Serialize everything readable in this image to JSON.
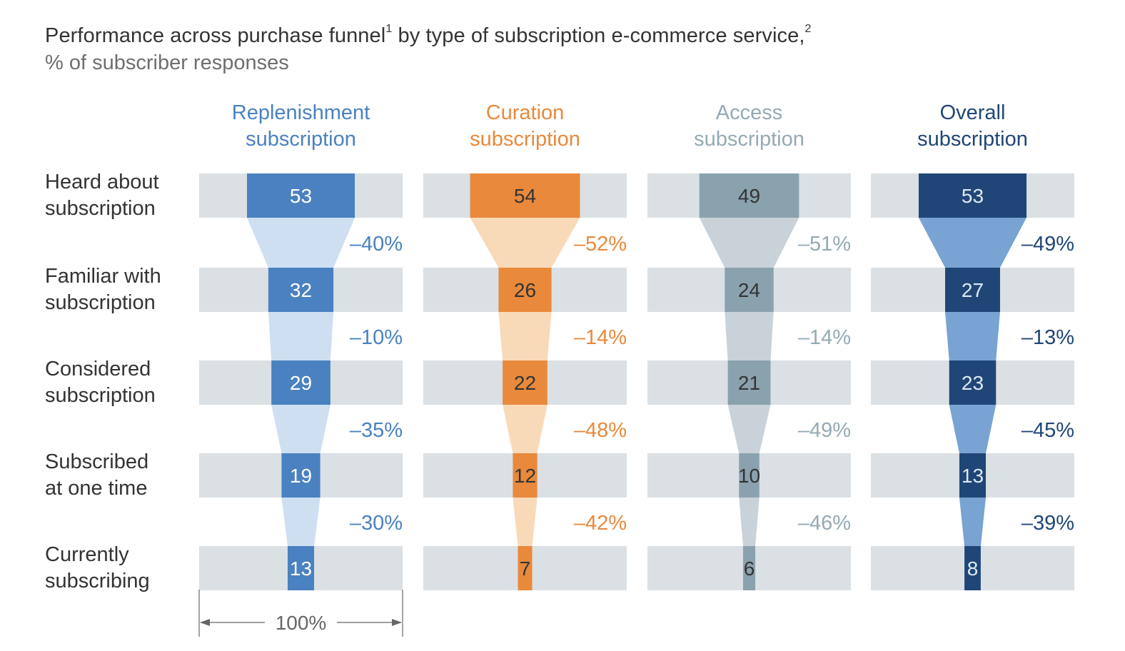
{
  "chart_data": {
    "type": "funnel",
    "title": "Performance across purchase funnel",
    "title_footnote_1": "1",
    "title_mid": " by type of subscription e-commerce service,",
    "title_footnote_2": "2",
    "subtitle": "% of subscriber responses",
    "stages": [
      [
        "Heard about",
        "subscription"
      ],
      [
        "Familiar with",
        "subscription"
      ],
      [
        "Considered",
        "subscription"
      ],
      [
        "Subscribed",
        "at one time"
      ],
      [
        "Currently",
        "subscribing"
      ]
    ],
    "scale_label": "100%",
    "xlim": [
      0,
      100
    ],
    "series": [
      {
        "name": [
          "Replenishment",
          "subscription"
        ],
        "color": "#4a81c0",
        "light": "#cddff1",
        "header_color": "#4a81c0",
        "drop_color": "#4a81c0",
        "value_text_color": "#ffffff",
        "values": [
          53,
          32,
          29,
          19,
          13
        ],
        "drops": [
          "–40%",
          "–10%",
          "–35%",
          "–30%"
        ]
      },
      {
        "name": [
          "Curation",
          "subscription"
        ],
        "color": "#e8893c",
        "light": "#f8dab9",
        "header_color": "#e8893c",
        "drop_color": "#e8893c",
        "value_text_color": "#333333",
        "values": [
          54,
          26,
          22,
          12,
          7
        ],
        "drops": [
          "–52%",
          "–14%",
          "–48%",
          "–42%"
        ]
      },
      {
        "name": [
          "Access",
          "subscription"
        ],
        "color": "#8aa2ae",
        "light": "#c9d2d8",
        "header_color": "#94aab4",
        "drop_color": "#94aab4",
        "value_text_color": "#333333",
        "values": [
          49,
          24,
          21,
          10,
          6
        ],
        "drops": [
          "–51%",
          "–14%",
          "–49%",
          "–46%"
        ]
      },
      {
        "name": [
          "Overall",
          "subscription"
        ],
        "color": "#1f4677",
        "light": "#78a3d2",
        "header_color": "#1f4677",
        "drop_color": "#1f4677",
        "value_text_color": "#dfe8f2",
        "values": [
          53,
          27,
          23,
          13,
          8
        ],
        "drops": [
          "–49%",
          "–13%",
          "–45%",
          "–39%"
        ]
      }
    ],
    "background_bar_color": "#dbe0e4"
  }
}
